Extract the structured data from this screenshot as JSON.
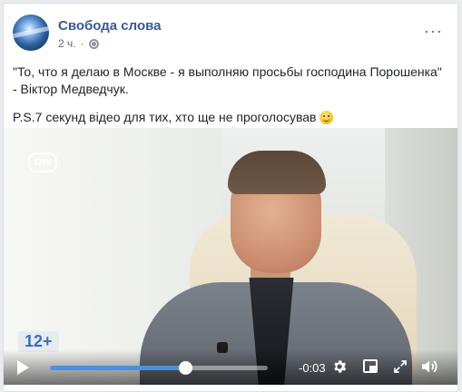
{
  "post": {
    "page_name": "Свобода слова",
    "time": "2 ч.",
    "separator": "·",
    "more_label": "···",
    "paragraph_1": "\"То, что я делаю в Москве - я выполняю просьбы господина Порошенка\" - Віктор Медведчук.",
    "paragraph_2": "P.S.7 секунд відео для тих, хто ще не проголосував"
  },
  "video": {
    "watermark": "DW",
    "age_rating": "12+",
    "time_remaining": "-0:03",
    "progress": 0.62,
    "accent_color": "#4a90e2"
  },
  "icons": {
    "privacy": "globe-icon",
    "emoji": "smile-icon",
    "play": "play-icon",
    "settings": "gear-icon",
    "mini_player": "mini-player-icon",
    "fullscreen": "fullscreen-icon",
    "volume": "volume-icon"
  }
}
